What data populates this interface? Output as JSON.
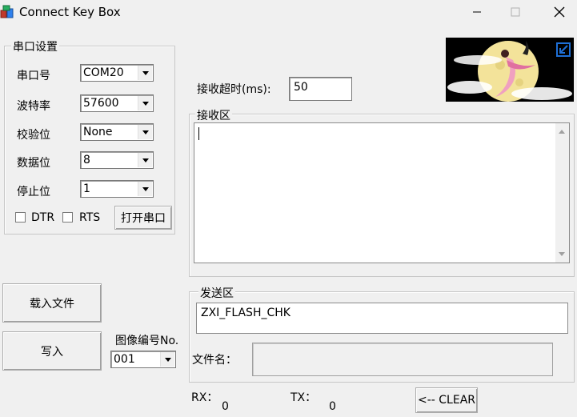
{
  "window": {
    "title": "Connect Key Box",
    "app_icon": "app-box-icon",
    "controls": [
      "minimize-icon",
      "maximize-icon",
      "close-icon"
    ]
  },
  "serial_settings": {
    "group_label": "串口设置",
    "port": {
      "label": "串口号",
      "value": "COM20"
    },
    "baud": {
      "label": "波特率",
      "value": "57600"
    },
    "parity": {
      "label": "校验位",
      "value": "None"
    },
    "data_bits": {
      "label": "数据位",
      "value": "8"
    },
    "stop_bits": {
      "label": "停止位",
      "value": "1"
    },
    "dtr": {
      "label": "DTR",
      "checked": false
    },
    "rts": {
      "label": "RTS",
      "checked": false
    },
    "open_button": "打开串口"
  },
  "receive_timeout": {
    "label": "接收超时(ms):",
    "value": "50"
  },
  "receive_area": {
    "group_label": "接收区",
    "content": ""
  },
  "buttons": {
    "load_file": "载入文件",
    "write": "写入",
    "clear": "<-- CLEAR"
  },
  "image_number": {
    "label": "图像编号No.",
    "value": "001"
  },
  "send_area": {
    "group_label": "发送区",
    "content": "ZXI_FLASH_CHK",
    "file_name_label": "文件名：",
    "file_name_value": ""
  },
  "stats": {
    "rx_label": "RX：",
    "rx_value": "0",
    "tx_label": "TX：",
    "tx_value": "0"
  },
  "colors": {
    "window_bg": "#f0f0f0",
    "border": "#c7c7c7",
    "logo_bg": "#000000",
    "accent_blue": "#1e6fd6"
  }
}
